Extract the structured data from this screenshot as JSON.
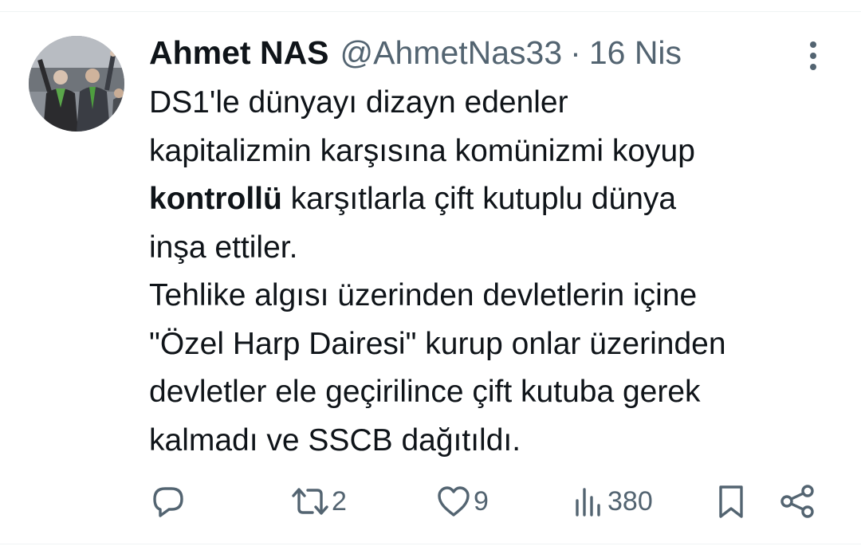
{
  "tweet": {
    "author": {
      "name": "Ahmet NAS",
      "handle": "@AhmetNas33",
      "avatar_icon": "profile-photo"
    },
    "separator": "·",
    "date": "16 Nis",
    "text": {
      "line1": "DS1'le dünyayı dizayn edenler",
      "line2": "kapitalizmin karşısına komünizmi koyup",
      "line3_bold": "kontrollü",
      "line3_rest": " karşıtlarla çift kutuplu dünya",
      "line4": "inşa ettiler.",
      "line5": "Tehlike algısı üzerinden devletlerin içine",
      "line6": "\"Özel Harp Dairesi\" kurup onlar üzerinden",
      "line7": "devletler ele geçirilince çift kutuba gerek",
      "line8": "kalmadı ve SSCB dağıtıldı."
    },
    "actions": {
      "reply": {
        "icon": "reply-icon",
        "count": ""
      },
      "retweet": {
        "icon": "retweet-icon",
        "count": "2"
      },
      "like": {
        "icon": "heart-icon",
        "count": "9"
      },
      "views": {
        "icon": "views-icon",
        "count": "380"
      },
      "bookmark": {
        "icon": "bookmark-icon"
      },
      "share": {
        "icon": "share-icon"
      }
    }
  },
  "colors": {
    "text_primary": "#0f1419",
    "text_secondary": "#536471",
    "divider": "#eff3f4"
  }
}
